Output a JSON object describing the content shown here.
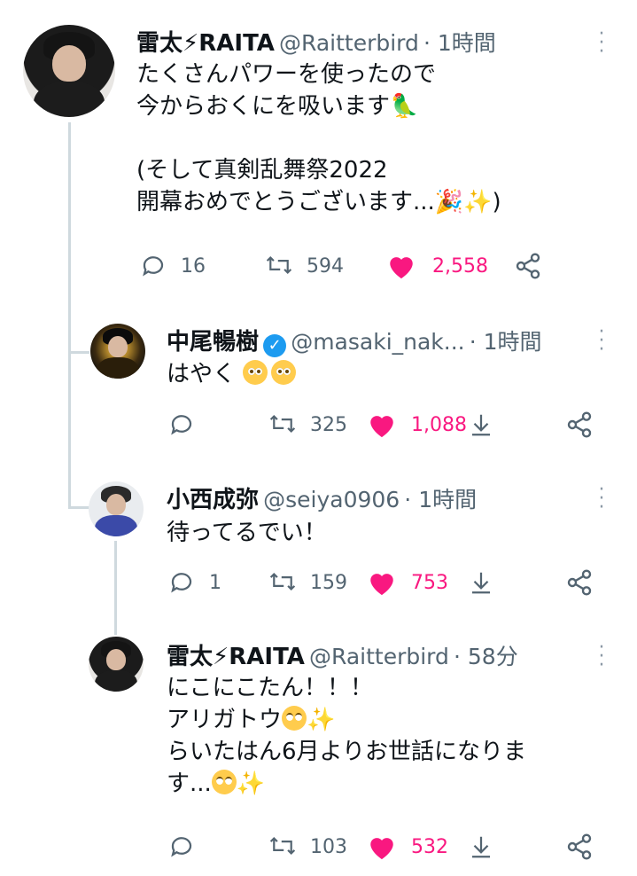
{
  "tweets": [
    {
      "name": "雷太⚡RAITA",
      "handle": "@Raitterbird",
      "time": "· 1時間",
      "lines": [
        "たくさんパワーを使ったので",
        "今からおくにを吸います",
        "",
        "(そして真剣乱舞祭2022",
        "開幕おめでとうございます..."
      ],
      "line2_emoji": "parrot",
      "line5_tail": ")",
      "line5_emojis": [
        "party-popper",
        "sparkles"
      ],
      "replies": "16",
      "retweets": "594",
      "likes": "2,558"
    },
    {
      "name": "中尾暢樹",
      "verified": true,
      "handle": "@masaki_nak...",
      "time": "· 1時間",
      "lines": [
        "はやく"
      ],
      "line_emojis": [
        "pleading-face",
        "pleading-face"
      ],
      "replies": "",
      "retweets": "325",
      "likes": "1,088"
    },
    {
      "name": "小西成弥",
      "handle": "@seiya0906",
      "time": "· 1時間",
      "lines": [
        "待ってるでい！"
      ],
      "replies": "1",
      "retweets": "159",
      "likes": "753"
    },
    {
      "name": "雷太⚡RAITA",
      "handle": "@Raitterbird",
      "time": "· 58分",
      "lines": [
        "にこにこたん！！！",
        "アリガトウ",
        "らいたはん6月よりお世話になりま",
        "す..."
      ],
      "replies": "",
      "retweets": "103",
      "likes": "532"
    }
  ],
  "colors": {
    "text": "#0f1419",
    "secondary": "#536471",
    "like": "#f91880",
    "verified": "#1d9bf0",
    "thread_line": "#cfd9de"
  }
}
